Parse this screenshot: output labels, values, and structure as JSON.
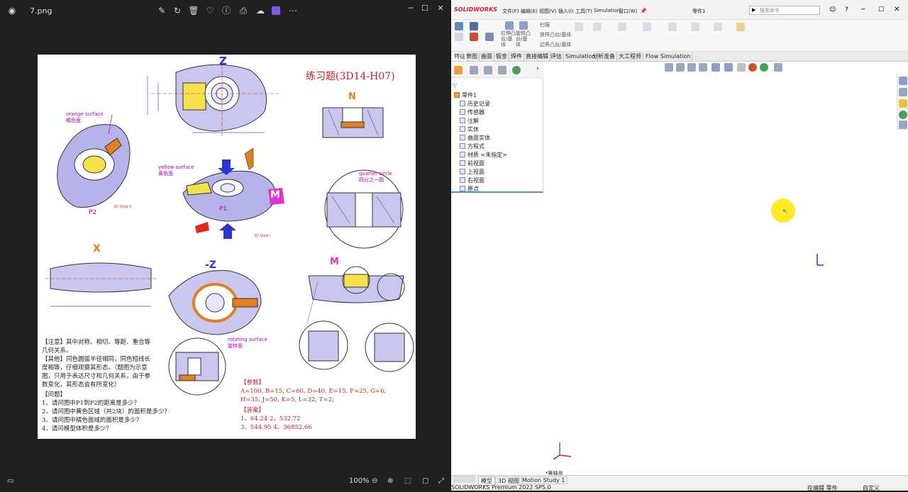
{
  "viewer": {
    "filename": "7.png",
    "zoom": "100%",
    "title_icons": [
      "edit-icon",
      "rotate-icon",
      "delete-icon",
      "heart-icon",
      "info-icon",
      "print-icon",
      "cloud-icon",
      "clipchamp-icon",
      "more-icon"
    ]
  },
  "sheet": {
    "title": "练习题(3D14-H07)",
    "label_orange_en": "orange surface",
    "label_orange_cn": "橘色面",
    "label_yellow_en": "yellow surface",
    "label_yellow_cn": "黄色面",
    "label_quarter_en": "quarter circle",
    "label_quarter_cn": "四分之一圆",
    "label_rotating_en": "rotating surface",
    "label_rotating_cn": "旋转面",
    "view_z": "Z",
    "view_n": "N",
    "view_m": "M",
    "view_m2": "M",
    "view_x": "X",
    "view_negz": "-Z",
    "p1": "P1",
    "p2": "P2",
    "view3d2": "3D View II",
    "view3d1": "3D View I",
    "note_lines": [
      "【注意】其中对称、相切、等距、重合等",
      "几何关系。",
      "【其他】同色圆弧半径相同，同色短线长",
      "度相等，仔细观察其形态。（题图为示意",
      "图，只用于表达尺寸和几何关系，由于参",
      "数变化，其形态会有所变化）"
    ],
    "question_title": "【问题】",
    "questions": [
      "1、请问图中P1到P2的距离是多少？",
      "2、请问图中黄色区域（共2块）的面积是多少？",
      "3、请问图中橘色面域的面积是多少？",
      "4、请问模型体积是多少？"
    ],
    "params_title": "【参数】",
    "params": [
      "A=100, B=15, C=60, D=40, E=15, F=25, G=6,",
      "H=35, J=50, K=5, L=32, T=2;"
    ],
    "answers_title": "【答案】",
    "answers": [
      "1、64.24  2、532.72",
      "3、544.95  4、36852.66"
    ]
  },
  "solidworks": {
    "logo": "SOLIDWORKS",
    "menus": [
      "文件(F)",
      "编辑(E)",
      "视图(V)",
      "插入(I)",
      "工具(T)",
      "Simulation",
      "窗口(W)"
    ],
    "doc_title": "零件1",
    "search_placeholder": "搜索命令",
    "tool_labels": [
      "拉伸凸台/基体",
      "旋转凸台/基体",
      "扫描",
      "放样凸台/基体",
      "边界凸台/基体"
    ],
    "tabs": [
      "特征",
      "草图",
      "曲面",
      "钣金",
      "焊件",
      "直接编辑",
      "评估",
      "Simulation",
      "分析准备",
      "大工程师",
      "Flow Simulation"
    ],
    "tree_root": "零件1",
    "tree_items": [
      "历史记录",
      "传感器",
      "注解",
      "实体",
      "曲面实体",
      "方程式",
      "材质 <未指定>",
      "前视面",
      "上视面",
      "右视面",
      "原点"
    ],
    "view_label": "*等轴测",
    "bottom_tabs": [
      "模型",
      "3D 视图",
      "Motion Study 1"
    ],
    "status_left": "SOLIDWORKS Premium 2022 SP5.0",
    "status_mid": "在编辑 零件",
    "status_right": "自定义"
  }
}
